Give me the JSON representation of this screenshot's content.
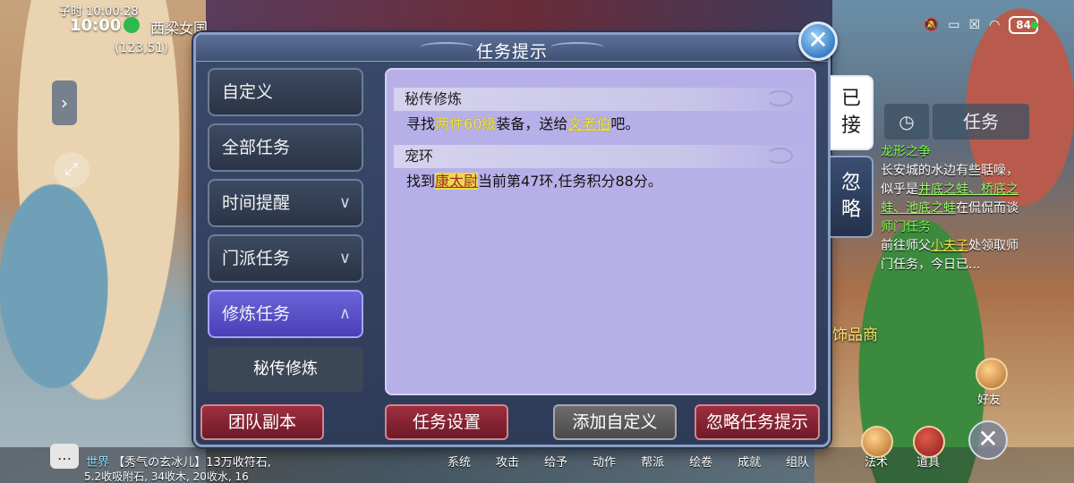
{
  "status_bar": {
    "time": "10:00",
    "battery": "84"
  },
  "hud": {
    "game_time": "子时 10:00:28",
    "location": "西梁女国",
    "coords": "(123,51)"
  },
  "dialog": {
    "title": "任务提示",
    "close_icon": "close-icon",
    "categories": [
      {
        "label": "自定义",
        "chevron": ""
      },
      {
        "label": "全部任务",
        "chevron": ""
      },
      {
        "label": "时间提醒",
        "chevron": "∨"
      },
      {
        "label": "门派任务",
        "chevron": "∨"
      },
      {
        "label": "修炼任务",
        "chevron": "∧"
      }
    ],
    "sub_item": "秘传修炼",
    "tasks": [
      {
        "title": "秘传修炼",
        "desc_pre": "寻找",
        "desc_hl1": "两件60级",
        "desc_mid": "装备，送给",
        "desc_hl2": "文老伯",
        "desc_post": "吧。"
      },
      {
        "title": "宠环",
        "desc_pre": "找到",
        "desc_hl1": "康太尉",
        "desc_post": "当前第47环,任务积分88分。"
      }
    ],
    "side_tabs": [
      "已接",
      "忽略"
    ],
    "buttons": {
      "team_dungeon": "团队副本",
      "task_settings": "任务设置",
      "add_custom": "添加自定义",
      "ignore_prompt": "忽略任务提示"
    }
  },
  "tracker": {
    "tabs": [
      "任务"
    ],
    "q1_title": "龙形之争",
    "q1_text_a": "长安城的水边有些聒噪，似乎是",
    "q1_link1": "井底之蛙",
    "q1_sep1": "、",
    "q1_link2": "桥底之蛙",
    "q1_sep2": "、",
    "q1_link3": "池底之蛙",
    "q1_text_b": "在侃侃而谈",
    "q2_title": "师门任务",
    "q2_text_a": "前往师父",
    "q2_link": "小夫子",
    "q2_text_b": "处领取师门任务，今日已..."
  },
  "right_hud": {
    "shop": "饰品商",
    "friend": "好友",
    "skill": "法术",
    "items": "道具"
  },
  "chat": {
    "channel": "世界",
    "line1": "【秀气の玄冰儿】13万收符石,",
    "line2": "5.2收吸附石, 34收木, 20收水, 16"
  },
  "bottom_menu": [
    "系统",
    "攻击",
    "给予",
    "动作",
    "帮派",
    "绘卷",
    "成就",
    "组队"
  ]
}
